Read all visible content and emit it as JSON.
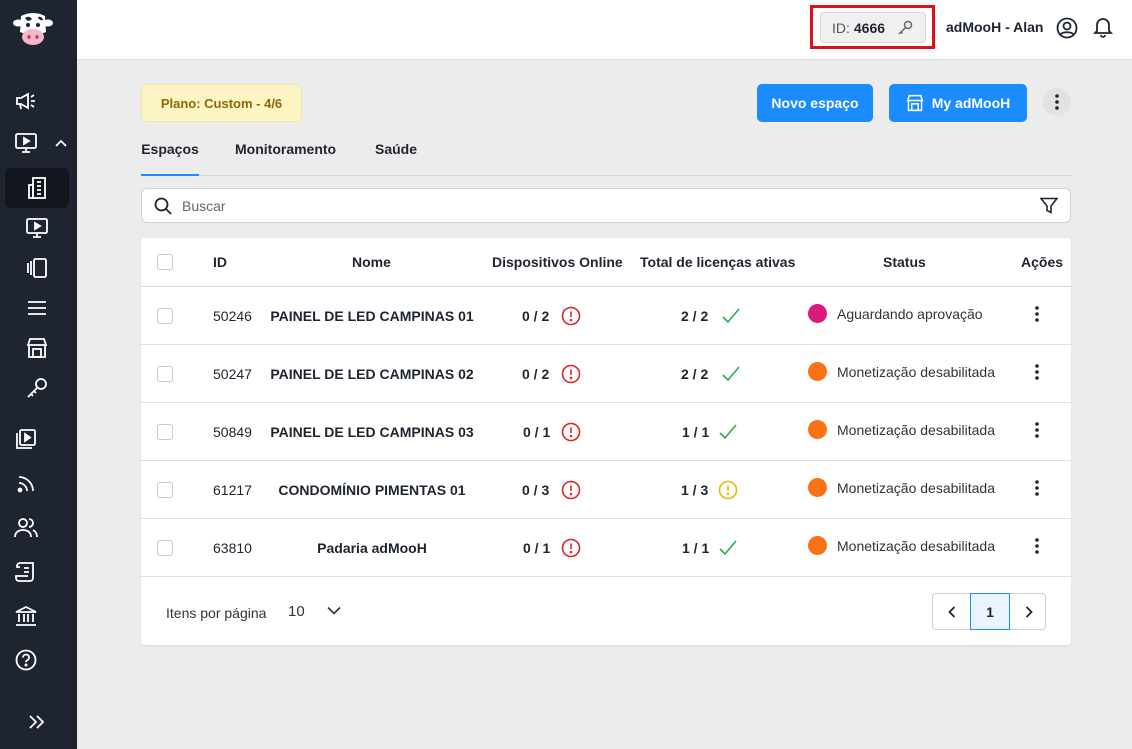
{
  "colors": {
    "sidebar_bg": "#1e2430",
    "primary": "#1a8cff",
    "highlight_outline": "#e0101b",
    "status_pending": "#d81b7b",
    "status_disabled": "#f97316",
    "error": "#e02424",
    "warning": "#e6b800",
    "success": "#22b14c"
  },
  "header": {
    "id_label": "ID:",
    "id_value": "4666",
    "account_name": "adMooH - Alan"
  },
  "sidebar": {
    "icons": [
      "megaphone-icon",
      "monitor-icon",
      "chevron-up-icon",
      "building-icon",
      "play-screen-icon",
      "panels-icon",
      "menu-lines-icon",
      "store-icon",
      "key-icon",
      "playlist-icon",
      "feed-icon",
      "users-icon",
      "script-icon",
      "bank-icon",
      "help-icon",
      "expand-icon"
    ]
  },
  "plan": {
    "label": "Plano: Custom - 4/6"
  },
  "actions": {
    "new_space": "Novo espaço",
    "my_admooh": "My adMooH"
  },
  "tabs": [
    {
      "label": "Espaços",
      "active": true
    },
    {
      "label": "Monitoramento",
      "active": false
    },
    {
      "label": "Saúde",
      "active": false
    }
  ],
  "search": {
    "placeholder": "Buscar",
    "value": ""
  },
  "table": {
    "headers": {
      "id": "ID",
      "name": "Nome",
      "devices": "Dispositivos Online",
      "licenses": "Total de licenças ativas",
      "status": "Status",
      "actions": "Ações"
    },
    "rows": [
      {
        "id": "50246",
        "name": "PAINEL DE LED CAMPINAS 01",
        "devices": "0 / 2",
        "devices_state": "error",
        "licenses": "2 / 2",
        "licenses_state": "ok",
        "status": "Aguardando aprovação",
        "status_kind": "pending"
      },
      {
        "id": "50247",
        "name": "PAINEL DE LED CAMPINAS 02",
        "devices": "0 / 2",
        "devices_state": "error",
        "licenses": "2 / 2",
        "licenses_state": "ok",
        "status": "Monetização desabilitada",
        "status_kind": "disabled"
      },
      {
        "id": "50849",
        "name": "PAINEL DE LED CAMPINAS 03",
        "devices": "0 / 1",
        "devices_state": "error",
        "licenses": "1 / 1",
        "licenses_state": "ok",
        "status": "Monetização desabilitada",
        "status_kind": "disabled"
      },
      {
        "id": "61217",
        "name": "CONDOMÍNIO PIMENTAS 01",
        "devices": "0 / 3",
        "devices_state": "error",
        "licenses": "1 / 3",
        "licenses_state": "warning",
        "status": "Monetização desabilitada",
        "status_kind": "disabled"
      },
      {
        "id": "63810",
        "name": "Padaria adMooH",
        "devices": "0 / 1",
        "devices_state": "error",
        "licenses": "1 / 1",
        "licenses_state": "ok",
        "status": "Monetização desabilitada",
        "status_kind": "disabled"
      }
    ]
  },
  "pagination": {
    "items_per_page_label": "Itens por página",
    "items_per_page": "10",
    "current_page": "1"
  }
}
